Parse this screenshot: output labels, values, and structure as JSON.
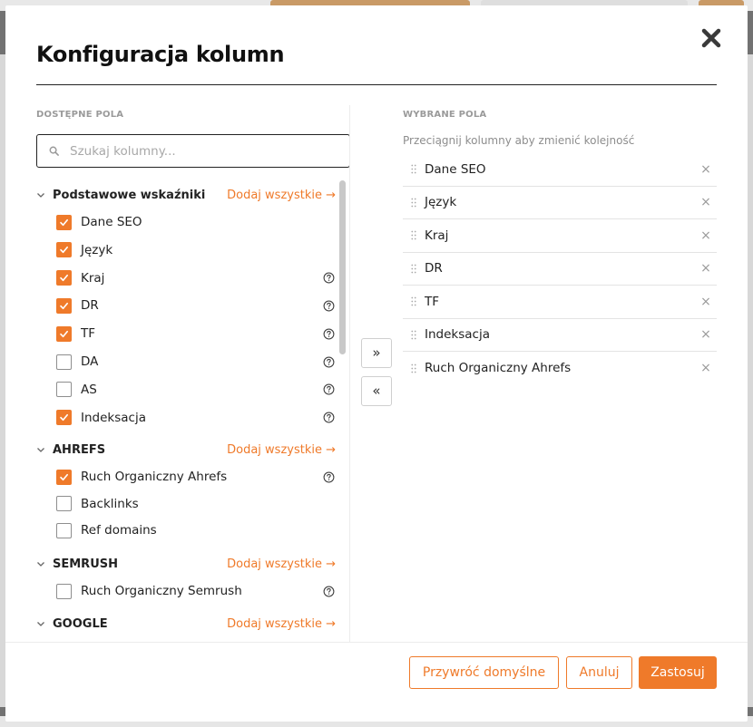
{
  "modal": {
    "title": "Konfiguracja kolumn",
    "close_icon": "close-icon"
  },
  "available": {
    "heading": "DOSTĘPNE POLA",
    "search_placeholder": "Szukaj kolumny...",
    "add_all_label": "Dodaj wszystkie →",
    "groups": [
      {
        "name": "Podstawowe wskaźniki",
        "items": [
          {
            "label": "Dane SEO",
            "checked": true,
            "help": false
          },
          {
            "label": "Język",
            "checked": true,
            "help": false
          },
          {
            "label": "Kraj",
            "checked": true,
            "help": true
          },
          {
            "label": "DR",
            "checked": true,
            "help": true
          },
          {
            "label": "TF",
            "checked": true,
            "help": true
          },
          {
            "label": "DA",
            "checked": false,
            "help": true
          },
          {
            "label": "AS",
            "checked": false,
            "help": true
          },
          {
            "label": "Indeksacja",
            "checked": true,
            "help": true
          }
        ]
      },
      {
        "name": "AHREFS",
        "items": [
          {
            "label": "Ruch Organiczny Ahrefs",
            "checked": true,
            "help": true
          },
          {
            "label": "Backlinks",
            "checked": false,
            "help": false
          },
          {
            "label": "Ref domains",
            "checked": false,
            "help": false
          }
        ]
      },
      {
        "name": "SEMRUSH",
        "items": [
          {
            "label": "Ruch Organiczny Semrush",
            "checked": false,
            "help": true
          }
        ]
      },
      {
        "name": "GOOGLE",
        "items": []
      }
    ]
  },
  "transfer": {
    "add_label": "»",
    "remove_label": "«"
  },
  "selected": {
    "heading": "WYBRANE POLA",
    "hint": "Przeciągnij kolumny aby zmienić kolejność",
    "items": [
      "Dane SEO",
      "Język",
      "Kraj",
      "DR",
      "TF",
      "Indeksacja",
      "Ruch Organiczny Ahrefs"
    ],
    "remove_label": "×"
  },
  "footer": {
    "reset_label": "Przywróć domyślne",
    "cancel_label": "Anuluj",
    "apply_label": "Zastosuj"
  },
  "colors": {
    "accent": "#ef7a2a"
  }
}
